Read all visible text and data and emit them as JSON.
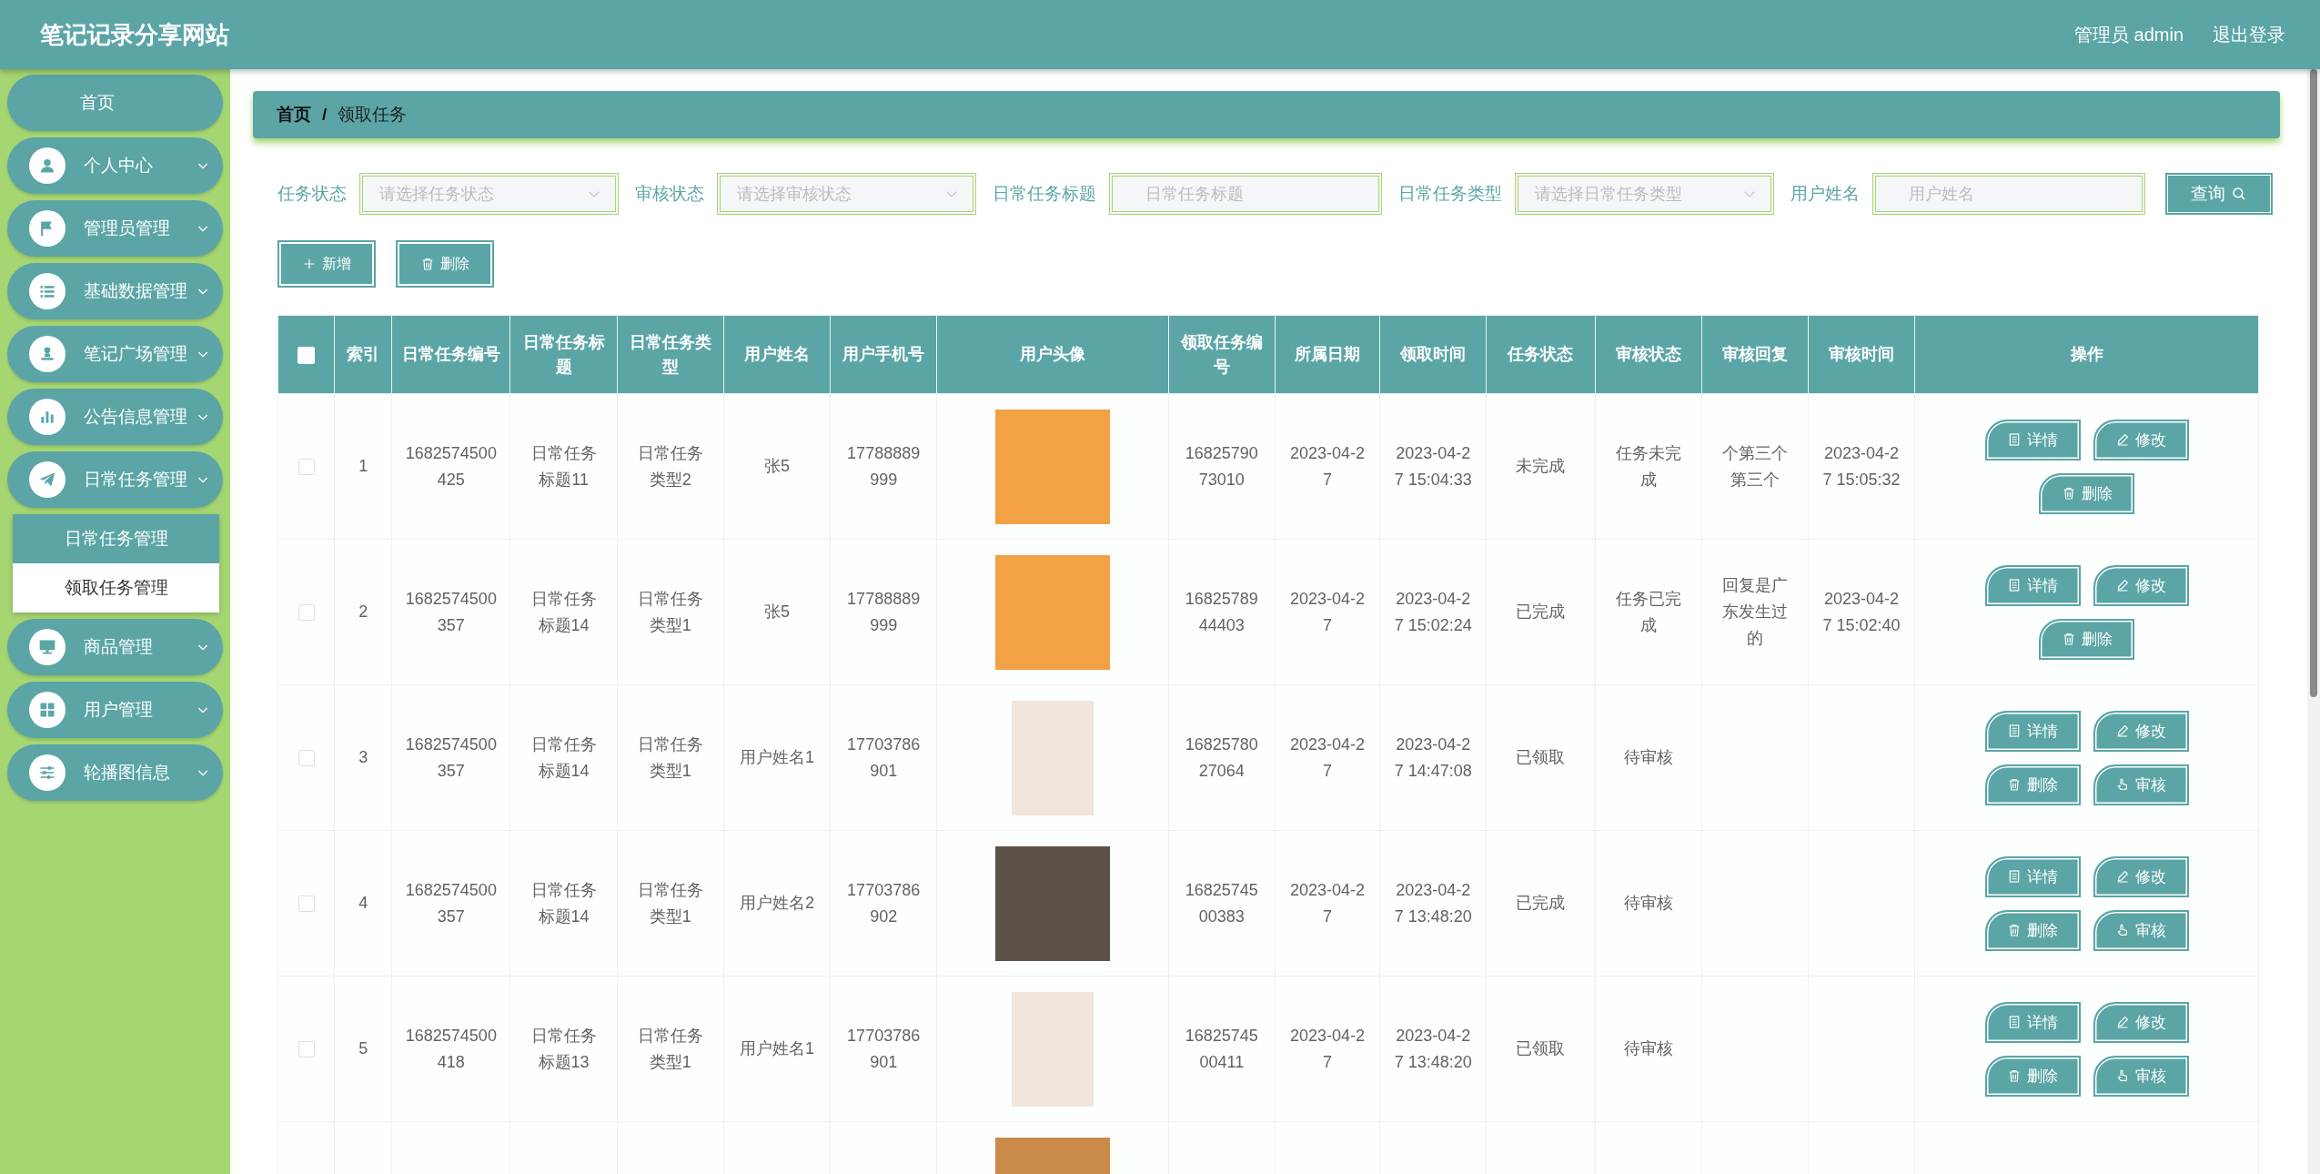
{
  "header": {
    "title": "笔记记录分享网站",
    "user": "管理员 admin",
    "logout": "退出登录"
  },
  "sidebar": {
    "items": [
      {
        "label": "首页"
      },
      {
        "label": "个人中心"
      },
      {
        "label": "管理员管理"
      },
      {
        "label": "基础数据管理"
      },
      {
        "label": "笔记广场管理"
      },
      {
        "label": "公告信息管理"
      },
      {
        "label": "日常任务管理",
        "children": [
          {
            "label": "日常任务管理",
            "selected": true
          },
          {
            "label": "领取任务管理",
            "selected": false
          }
        ]
      },
      {
        "label": "商品管理"
      },
      {
        "label": "用户管理"
      },
      {
        "label": "轮播图信息"
      }
    ]
  },
  "breadcrumb": {
    "home": "首页",
    "separator": "/",
    "current": "领取任务"
  },
  "filters": [
    {
      "label": "任务状态",
      "kind": "select",
      "placeholder": "请选择任务状态"
    },
    {
      "label": "审核状态",
      "kind": "select",
      "placeholder": "请选择审核状态"
    },
    {
      "label": "日常任务标题",
      "kind": "input",
      "placeholder": "日常任务标题"
    },
    {
      "label": "日常任务类型",
      "kind": "select",
      "placeholder": "请选择日常任务类型"
    },
    {
      "label": "用户姓名",
      "kind": "input",
      "placeholder": "用户姓名"
    }
  ],
  "query_button": "查询",
  "toolbar": [
    {
      "label": "新增",
      "kind": "add"
    },
    {
      "label": "删除",
      "kind": "delete"
    }
  ],
  "table": {
    "select_all": {
      "checked": false
    },
    "columns": [
      "索引",
      "日常任务编号",
      "日常任务标题",
      "日常任务类型",
      "用户姓名",
      "用户手机号",
      "用户头像",
      "领取任务编号",
      "所属日期",
      "领取时间",
      "任务状态",
      "审核状态",
      "审核回复",
      "审核时间",
      "操作"
    ],
    "rows": [
      {
        "checked": false,
        "index": "1",
        "task_no": "1682574500425",
        "task_title": "日常任务标题11",
        "task_type": "日常任务类型2",
        "user_name": "张5",
        "phone": "17788889999",
        "avatar": {
          "kind": "cartoon"
        },
        "claim_no": "1682579073010",
        "date": "2023-04-27",
        "claim_time": "2023-04-27 15:04:33",
        "task_status": "未完成",
        "review_status": "任务未完成",
        "review_reply": "个第三个第三个",
        "review_time": "2023-04-27 15:05:32",
        "actions": [
          {
            "label": "详情",
            "kind": "detail"
          },
          {
            "label": "修改",
            "kind": "edit"
          },
          {
            "label": "删除",
            "kind": "delete"
          }
        ]
      },
      {
        "checked": false,
        "index": "2",
        "task_no": "1682574500357",
        "task_title": "日常任务标题14",
        "task_type": "日常任务类型1",
        "user_name": "张5",
        "phone": "17788889999",
        "avatar": {
          "kind": "cartoon"
        },
        "claim_no": "1682578944403",
        "date": "2023-04-27",
        "claim_time": "2023-04-27 15:02:24",
        "task_status": "已完成",
        "review_status": "任务已完成",
        "review_reply": "回复是广东发生过的",
        "review_time": "2023-04-27 15:02:40",
        "actions": [
          {
            "label": "详情",
            "kind": "detail"
          },
          {
            "label": "修改",
            "kind": "edit"
          },
          {
            "label": "删除",
            "kind": "delete"
          }
        ]
      },
      {
        "checked": false,
        "index": "3",
        "task_no": "1682574500357",
        "task_title": "日常任务标题14",
        "task_type": "日常任务类型1",
        "user_name": "用户姓名1",
        "phone": "17703786901",
        "avatar": {
          "kind": "illustration"
        },
        "claim_no": "1682578027064",
        "date": "2023-04-27",
        "claim_time": "2023-04-27 14:47:08",
        "task_status": "已领取",
        "review_status": "待审核",
        "actions": [
          {
            "label": "详情",
            "kind": "detail"
          },
          {
            "label": "修改",
            "kind": "edit"
          },
          {
            "label": "删除",
            "kind": "delete"
          },
          {
            "label": "审核",
            "kind": "review"
          }
        ]
      },
      {
        "checked": false,
        "index": "4",
        "task_no": "1682574500357",
        "task_title": "日常任务标题14",
        "task_type": "日常任务类型1",
        "user_name": "用户姓名2",
        "phone": "17703786902",
        "avatar": {
          "kind": "photo"
        },
        "claim_no": "1682574500383",
        "date": "2023-04-27",
        "claim_time": "2023-04-27 13:48:20",
        "task_status": "已完成",
        "review_status": "待审核",
        "actions": [
          {
            "label": "详情",
            "kind": "detail"
          },
          {
            "label": "修改",
            "kind": "edit"
          },
          {
            "label": "删除",
            "kind": "delete"
          },
          {
            "label": "审核",
            "kind": "review"
          }
        ]
      },
      {
        "checked": false,
        "index": "5",
        "task_no": "1682574500418",
        "task_title": "日常任务标题13",
        "task_type": "日常任务类型1",
        "user_name": "用户姓名1",
        "phone": "17703786901",
        "avatar": {
          "kind": "illustration"
        },
        "claim_no": "1682574500411",
        "date": "2023-04-27",
        "claim_time": "2023-04-27 13:48:20",
        "task_status": "已领取",
        "review_status": "待审核",
        "actions": [
          {
            "label": "详情",
            "kind": "detail"
          },
          {
            "label": "修改",
            "kind": "edit"
          },
          {
            "label": "删除",
            "kind": "delete"
          },
          {
            "label": "审核",
            "kind": "review"
          }
        ]
      },
      {
        "avatar": {
          "kind": "animal"
        }
      }
    ]
  }
}
